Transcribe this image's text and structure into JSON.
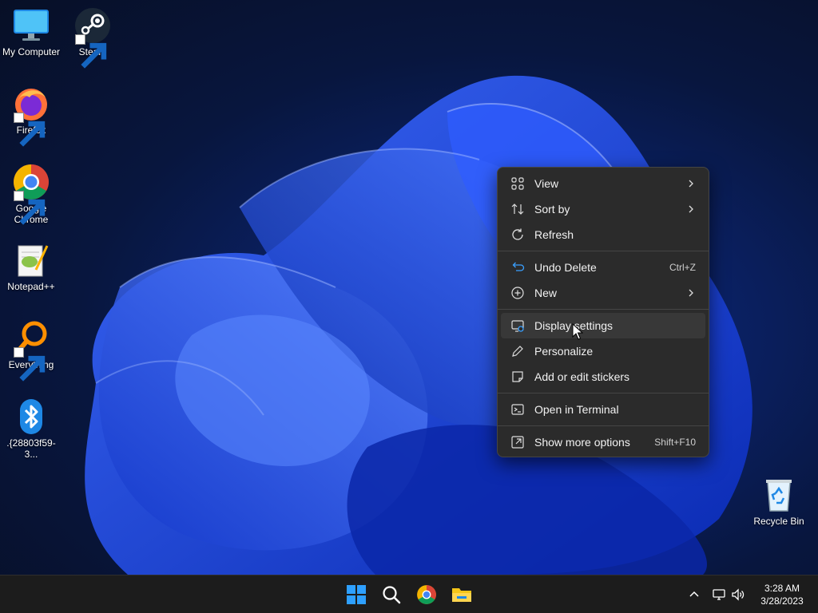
{
  "desktop": {
    "icons": [
      {
        "label": "My Computer",
        "icon": "monitor-icon",
        "shortcut": false
      },
      {
        "label": "Steam",
        "icon": "steam-icon",
        "shortcut": true
      },
      {
        "label": "Firefox",
        "icon": "firefox-icon",
        "shortcut": true
      },
      {
        "label": "Google Chrome",
        "icon": "chrome-icon",
        "shortcut": true
      },
      {
        "label": "Notepad++",
        "icon": "notepadpp-icon",
        "shortcut": false
      },
      {
        "label": "Everything",
        "icon": "everything-icon",
        "shortcut": true
      },
      {
        "label": ".{28803f59-3...",
        "icon": "bluetooth-icon",
        "shortcut": false
      },
      {
        "label": "Recycle Bin",
        "icon": "recycle-bin-icon",
        "shortcut": false
      }
    ]
  },
  "context_menu": {
    "items": [
      {
        "label": "View",
        "icon": "grid-view-icon",
        "submenu": true
      },
      {
        "label": "Sort by",
        "icon": "sort-icon",
        "submenu": true
      },
      {
        "label": "Refresh",
        "icon": "refresh-icon"
      },
      {
        "label": "Undo Delete",
        "icon": "undo-icon",
        "shortcut": "Ctrl+Z"
      },
      {
        "label": "New",
        "icon": "new-plus-icon",
        "submenu": true
      },
      {
        "label": "Display settings",
        "icon": "display-settings-icon",
        "highlighted": true
      },
      {
        "label": "Personalize",
        "icon": "pencil-icon"
      },
      {
        "label": "Add or edit stickers",
        "icon": "sticker-icon"
      },
      {
        "label": "Open in Terminal",
        "icon": "terminal-icon"
      },
      {
        "label": "Show more options",
        "icon": "more-options-icon",
        "shortcut": "Shift+F10"
      }
    ]
  },
  "taskbar": {
    "pinned": [
      "start-icon",
      "search-icon",
      "chrome-icon",
      "file-explorer-icon"
    ],
    "tray": [
      "chevron-up-icon",
      "network-icon",
      "volume-icon"
    ],
    "clock": {
      "time": "3:28 AM",
      "date": "3/28/2023"
    }
  },
  "colors": {
    "menu_bg": "#2b2b2b",
    "menu_hover": "#383838",
    "taskbar_bg": "#1c1c1c",
    "wallpaper_blue": "#1a4bff"
  }
}
